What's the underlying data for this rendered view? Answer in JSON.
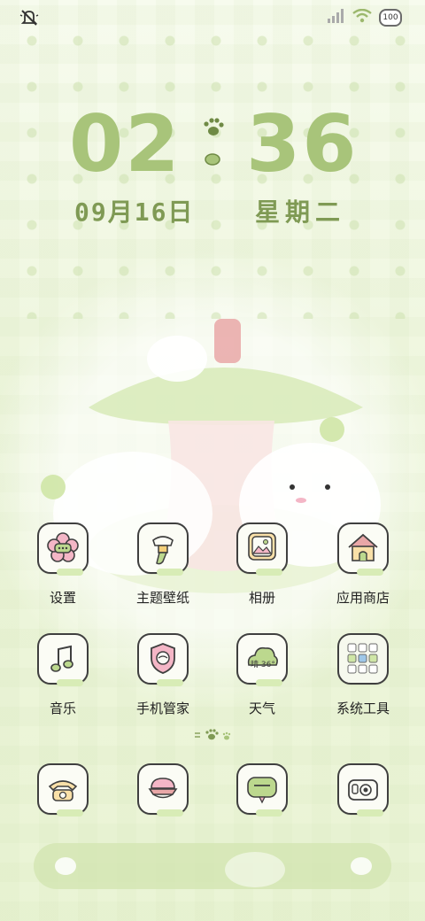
{
  "status_bar": {
    "left_icon": "bell-off-icon",
    "signal_icon": "signal-bars-icon",
    "wifi_icon": "wifi-icon",
    "battery": "100"
  },
  "clock": {
    "hours": "02",
    "minutes": "36",
    "separator_icon": "paw-icon",
    "date": "09月16日",
    "weekday": "星期二"
  },
  "apps_row1": [
    {
      "label": "设置",
      "icon": "flower-settings-icon"
    },
    {
      "label": "主题壁纸",
      "icon": "paint-brush-icon"
    },
    {
      "label": "相册",
      "icon": "photo-album-icon"
    },
    {
      "label": "应用商店",
      "icon": "house-store-icon"
    }
  ],
  "apps_row2": [
    {
      "label": "音乐",
      "icon": "music-note-icon"
    },
    {
      "label": "手机管家",
      "icon": "shield-icon"
    },
    {
      "label": "天气",
      "icon": "weather-cloud-icon",
      "badge": "晴 36°"
    },
    {
      "label": "系统工具",
      "icon": "folder-grid-icon"
    }
  ],
  "dock_apps": [
    {
      "icon": "phone-icon"
    },
    {
      "icon": "messages-icon"
    },
    {
      "icon": "chat-bubble-icon"
    },
    {
      "icon": "camera-icon"
    }
  ],
  "colors": {
    "clock": "#a8c47a",
    "date": "#7f9a54",
    "icon_border": "#3f3f3f",
    "accent_green": "#bcd88e",
    "pink": "#f4b6c6"
  }
}
